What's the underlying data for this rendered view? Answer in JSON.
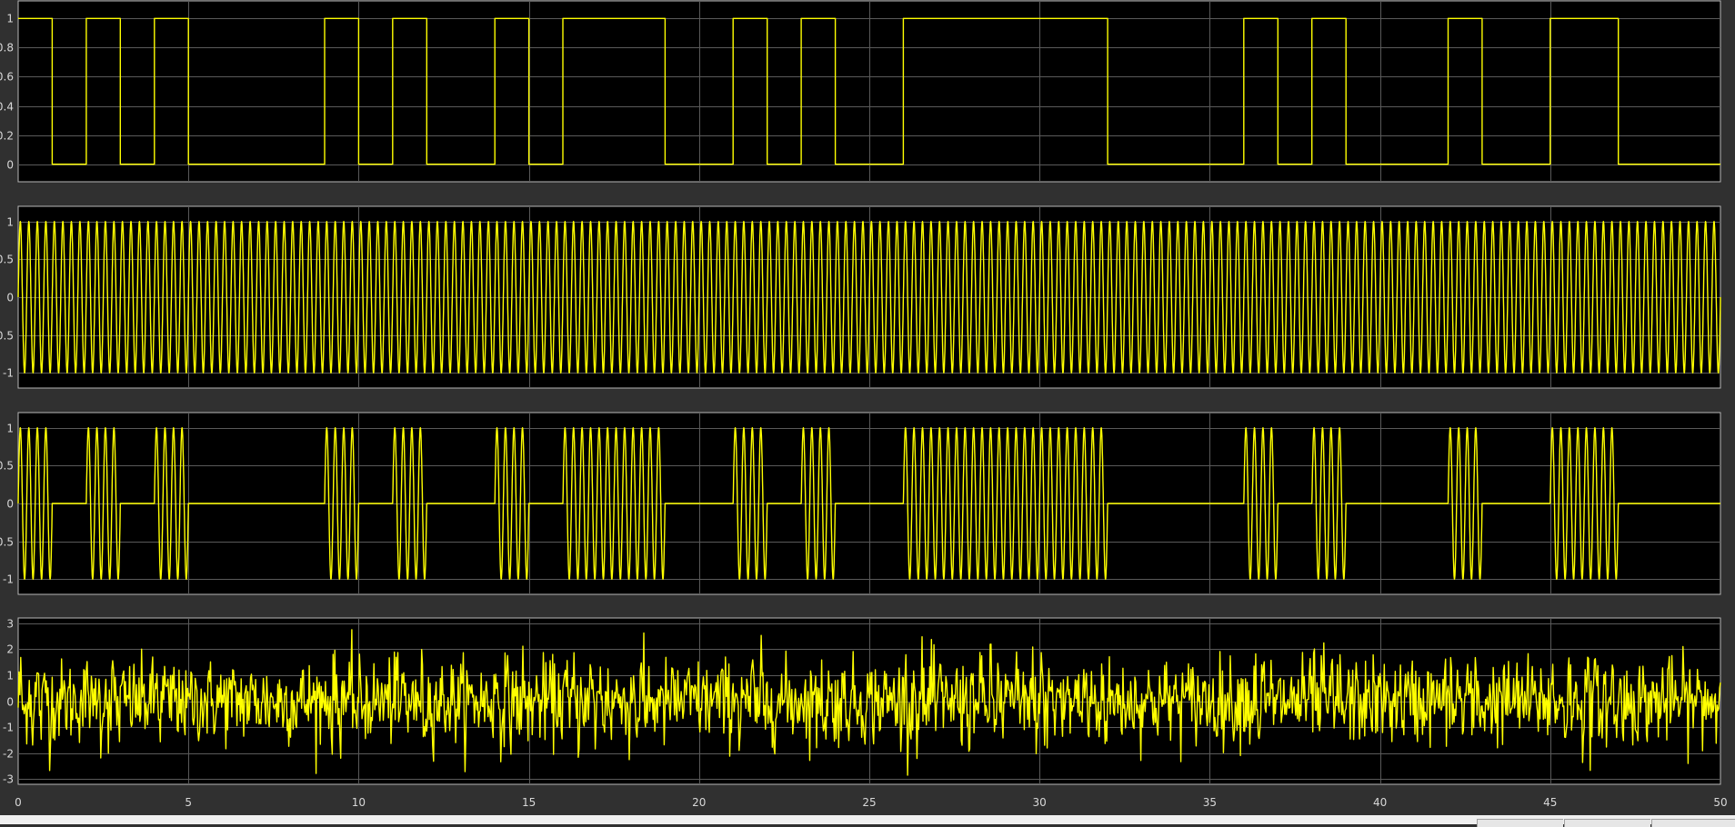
{
  "colors": {
    "background": "#303030",
    "axes": "#000000",
    "grid": "#5a5a5a",
    "frame": "#b8b8b8",
    "signal": "#ffff00",
    "text": "#d8d8d8"
  },
  "chart_data": [
    {
      "type": "line",
      "step": true,
      "title": "",
      "xlabel": "",
      "ylabel": "",
      "xlim": [
        0,
        50
      ],
      "ylim": [
        -0.12,
        1.12
      ],
      "grid": true,
      "xticks": [
        0,
        5,
        10,
        15,
        20,
        25,
        30,
        35,
        40,
        45,
        50
      ],
      "xtick_labels_visible": false,
      "yticks": [
        0,
        0.2,
        0.4,
        0.6,
        0.8,
        1
      ],
      "ytick_labels": [
        "0",
        "0.2",
        "0.4",
        "0.6",
        "0.8",
        "1"
      ],
      "bits": [
        1,
        0,
        1,
        0,
        1,
        0,
        0,
        0,
        0,
        1,
        0,
        1,
        0,
        0,
        1,
        0,
        1,
        1,
        1,
        0,
        0,
        1,
        0,
        1,
        0,
        0,
        1,
        1,
        1,
        1,
        1,
        1,
        0,
        0,
        0,
        0,
        1,
        0,
        1,
        0,
        0,
        0,
        1,
        0,
        0,
        1,
        1,
        0,
        0,
        0
      ],
      "series": [
        {
          "color": "#ffff00"
        }
      ]
    },
    {
      "type": "line",
      "title": "",
      "xlabel": "",
      "ylabel": "",
      "xlim": [
        0,
        50
      ],
      "ylim": [
        -1.2,
        1.2
      ],
      "grid": true,
      "xticks": [
        0,
        5,
        10,
        15,
        20,
        25,
        30,
        35,
        40,
        45,
        50
      ],
      "xtick_labels_visible": false,
      "yticks": [
        -1,
        -0.5,
        0,
        0.5,
        1
      ],
      "ytick_labels": [
        "-1",
        "-0.5",
        "0",
        "0.5",
        "1"
      ],
      "function": "sin(2*pi*f*t)",
      "frequency": 4,
      "series": [
        {
          "color": "#ffff00"
        }
      ]
    },
    {
      "type": "line",
      "title": "",
      "xlabel": "",
      "ylabel": "",
      "xlim": [
        0,
        50
      ],
      "ylim": [
        -1.2,
        1.2
      ],
      "grid": true,
      "xticks": [
        0,
        5,
        10,
        15,
        20,
        25,
        30,
        35,
        40,
        45,
        50
      ],
      "xtick_labels_visible": false,
      "yticks": [
        -1,
        -0.5,
        0,
        0.5,
        1
      ],
      "ytick_labels": [
        "-1",
        "-0.5",
        "0",
        "0.5",
        "1"
      ],
      "function": "bit(t)*sin(2*pi*f*t)",
      "frequency": 4,
      "series": [
        {
          "color": "#ffff00"
        }
      ]
    },
    {
      "type": "line",
      "title": "",
      "xlabel": "",
      "ylabel": "",
      "xlim": [
        0,
        50
      ],
      "ylim": [
        -3.2,
        3.2
      ],
      "grid": true,
      "xticks": [
        0,
        5,
        10,
        15,
        20,
        25,
        30,
        35,
        40,
        45,
        50
      ],
      "xtick_labels_visible": true,
      "xtick_labels": [
        "0",
        "5",
        "10",
        "15",
        "20",
        "25",
        "30",
        "35",
        "40",
        "45",
        "50"
      ],
      "yticks": [
        -3,
        -2,
        -1,
        0,
        1,
        2,
        3
      ],
      "ytick_labels": [
        "-3",
        "-2",
        "-1",
        "0",
        "1",
        "2",
        "3"
      ],
      "function": "modulated signal + gaussian noise",
      "noise_std": 0.8,
      "samples_per_unit": 40,
      "series": [
        {
          "color": "#ffff00"
        }
      ]
    }
  ]
}
